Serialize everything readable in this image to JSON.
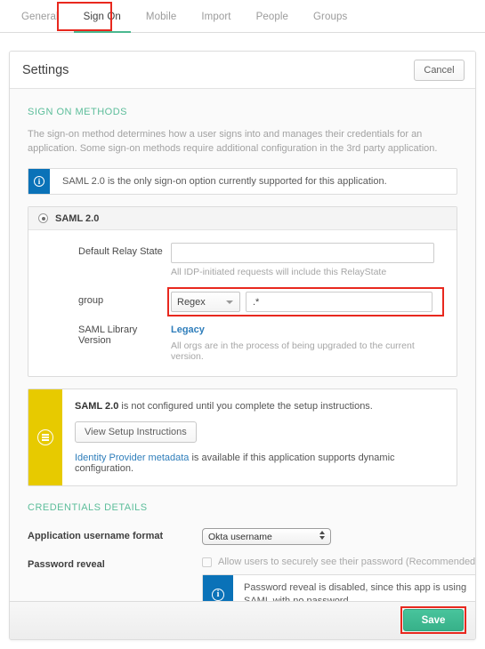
{
  "tabs": [
    {
      "label": "General",
      "active": false
    },
    {
      "label": "Sign On",
      "active": true
    },
    {
      "label": "Mobile",
      "active": false
    },
    {
      "label": "Import",
      "active": false
    },
    {
      "label": "People",
      "active": false
    },
    {
      "label": "Groups",
      "active": false
    }
  ],
  "card": {
    "title": "Settings",
    "cancel_label": "Cancel"
  },
  "sign_on": {
    "section_title": "SIGN ON METHODS",
    "description": "The sign-on method determines how a user signs into and manages their credentials for an application. Some sign-on methods require additional configuration in the 3rd party application.",
    "info_banner": "SAML 2.0 is the only sign-on option currently supported for this application.",
    "method_label": "SAML 2.0",
    "fields": {
      "relay_state_label": "Default Relay State",
      "relay_state_value": "",
      "relay_state_placeholder": "",
      "relay_state_hint": "All IDP-initiated requests will include this RelayState",
      "group_label": "group",
      "group_match_type": "Regex",
      "group_value": ".*",
      "library_label": "SAML Library Version",
      "library_link": "Legacy",
      "library_hint": "All orgs are in the process of being upgraded to the current version."
    },
    "setup": {
      "strong": "SAML 2.0",
      "rest": " is not configured until you complete the setup instructions.",
      "button_label": "View Setup Instructions",
      "metadata_link": "Identity Provider metadata",
      "metadata_rest": " is available if this application supports dynamic configuration."
    }
  },
  "credentials": {
    "section_title": "CREDENTIALS DETAILS",
    "username_format_label": "Application username format",
    "username_format_value": "Okta username",
    "password_reveal_label": "Password reveal",
    "password_reveal_checkbox_label": "Allow users to securely see their password (Recommended)",
    "password_reveal_info": "Password reveal is disabled, since this app is using SAML with no password."
  },
  "footer": {
    "save_label": "Save"
  },
  "icons": {
    "info": "i",
    "list": "list-icon",
    "caret_down": "chevron-down-icon"
  },
  "colors": {
    "accent_green": "#5cbd9a",
    "save_green": "#37b189",
    "info_blue": "#0a72b8",
    "warning_yellow": "#e7ca00",
    "link_blue": "#2f7ebb",
    "annotation_red": "#e8281e"
  }
}
